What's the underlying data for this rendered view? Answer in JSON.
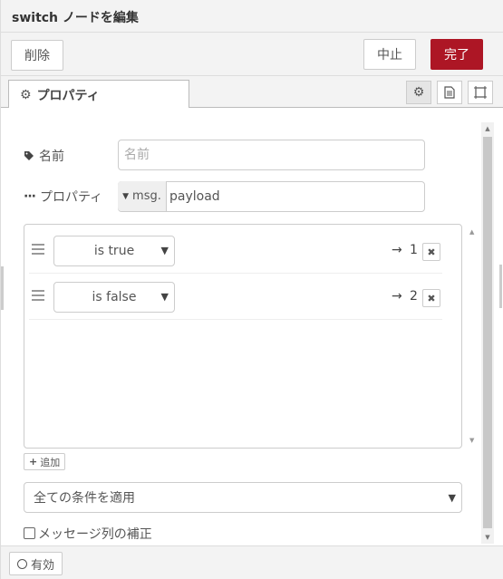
{
  "dialog": {
    "title": "switch ノードを編集"
  },
  "toolbar": {
    "delete_label": "削除",
    "cancel_label": "中止",
    "done_label": "完了"
  },
  "tabs": {
    "properties_label": "プロパティ"
  },
  "form": {
    "name_label": "名前",
    "name_placeholder": "名前",
    "property_label": "プロパティ",
    "property_type": "msg.",
    "property_value": "payload"
  },
  "rules": [
    {
      "operator": "is true",
      "output": "1"
    },
    {
      "operator": "is false",
      "output": "2"
    }
  ],
  "rule_controls": {
    "add_label": "追加",
    "remove_symbol": "✖",
    "arrow": "→"
  },
  "options": {
    "check_mode": "全ての条件を適用",
    "recreate_sequences_label": "メッセージ列の補正",
    "recreate_sequences_checked": false
  },
  "footer": {
    "enabled_label": "有効"
  },
  "colors": {
    "primary": "#ad1625",
    "header_bg": "#f3f3f3",
    "border": "#cccccc"
  },
  "icons": [
    "gear-icon",
    "tag-icon",
    "ellipsis-icon",
    "document-icon",
    "frame-icon",
    "plus-icon",
    "circle-icon"
  ]
}
